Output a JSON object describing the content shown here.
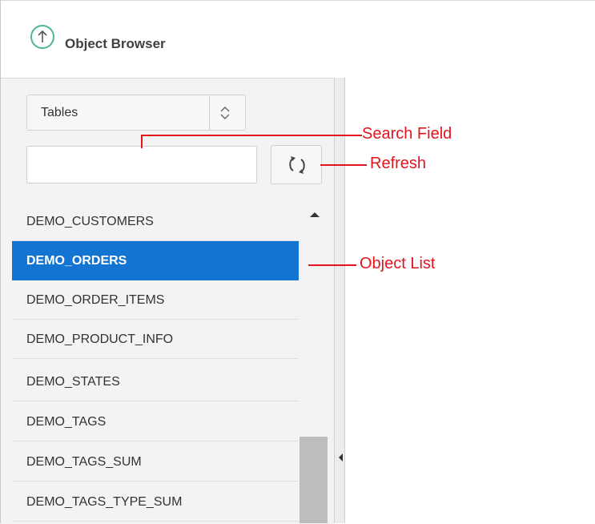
{
  "header": {
    "title": "Object Browser",
    "icon": "upload-circle-icon",
    "icon_color": "#4fb68e"
  },
  "object_type_select": {
    "selected": "Tables"
  },
  "search": {
    "value": "",
    "placeholder": ""
  },
  "refresh": {
    "icon": "refresh-icon"
  },
  "object_list": {
    "items": [
      "DEMO_CUSTOMERS",
      "DEMO_ORDERS",
      "DEMO_ORDER_ITEMS",
      "DEMO_PRODUCT_INFO",
      "DEMO_STATES",
      "DEMO_TAGS",
      "DEMO_TAGS_SUM",
      "DEMO_TAGS_TYPE_SUM"
    ],
    "selected_index": 1,
    "selected_color": "#1474d1"
  },
  "callouts": {
    "search_field": "Search Field",
    "refresh": "Refresh",
    "object_list": "Object List",
    "color": "#e3141e"
  }
}
